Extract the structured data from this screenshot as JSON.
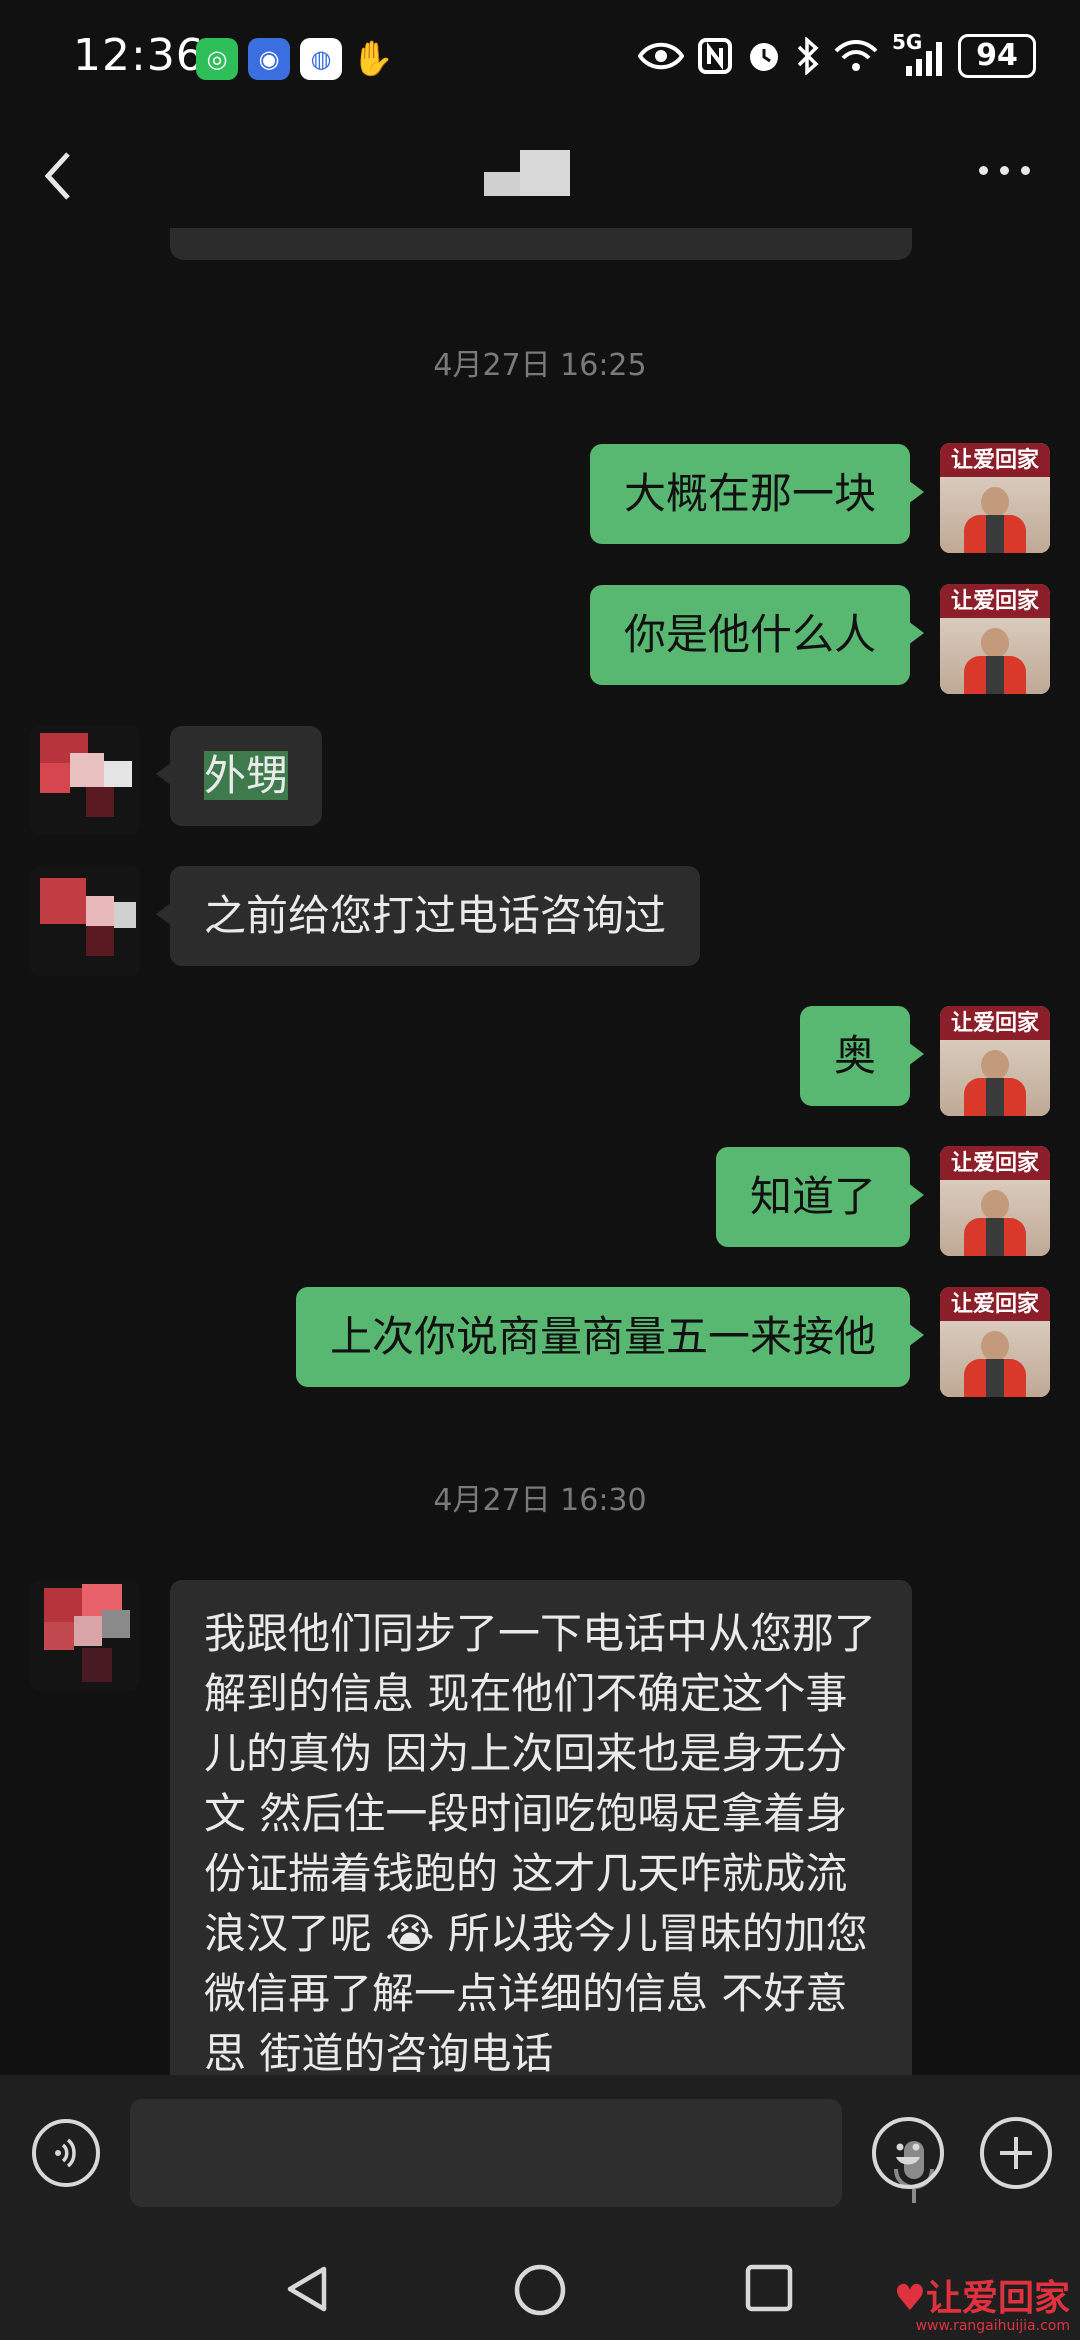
{
  "status_bar": {
    "time": "12:36",
    "battery": "94",
    "network": "5G",
    "icons": [
      "app-green-icon",
      "app-blue-icon",
      "app-map-icon",
      "hand-icon",
      "eye-icon",
      "nfc-icon",
      "alarm-icon",
      "bluetooth-icon",
      "wifi-icon",
      "signal-icon"
    ]
  },
  "header": {
    "back_icon": "chevron-left-icon",
    "more_icon": "more-dots-icon"
  },
  "messages": {
    "ts1": "4月27日 16:25",
    "m1": "大概在那一块",
    "m2": "你是他什么人",
    "m3": "外甥",
    "m4": "之前给您打过电话咨询过",
    "m5": "奥",
    "m6": "知道了",
    "m7": "上次你说商量商量五一来接他",
    "ts2": "4月27日 16:30",
    "m8": "我跟他们同步了一下电话中从您那了解到的信息 现在他们不确定这个事儿的真伪 因为上次回来也是身无分文 然后住一段时间吃饱喝足拿着身份证揣着钱跑的 这才几天咋就成流浪汉了呢 😭 所以我今儿冒昧的加您微信再了解一点详细的信息 不好意思 街道的咨询电话"
  },
  "avatar": {
    "self_banner": "让爱回家"
  },
  "input_bar": {
    "voice_icon": "voice-mode-icon",
    "mic_icon": "microphone-icon",
    "emoji_icon": "emoji-icon",
    "plus_icon": "plus-icon"
  },
  "watermark": {
    "text": "让爱回家",
    "url": "www.rangaihuijia.com"
  }
}
